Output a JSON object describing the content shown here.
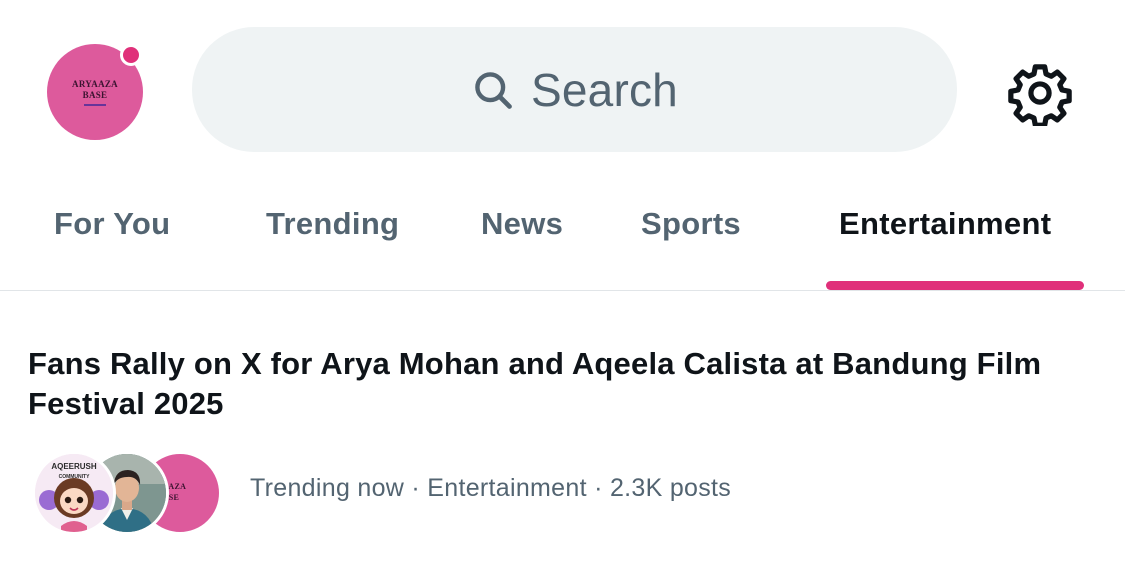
{
  "header": {
    "avatar_logo": [
      "ARYAAZA",
      "BASE"
    ],
    "search_placeholder": "Search",
    "search_icon": "search-icon",
    "settings_icon": "gear-icon",
    "notification_dot_color": "#e0307a"
  },
  "tabs": [
    {
      "label": "For You",
      "active": false
    },
    {
      "label": "Trending",
      "active": false
    },
    {
      "label": "News",
      "active": false
    },
    {
      "label": "Sports",
      "active": false
    },
    {
      "label": "Entertainment",
      "active": true
    }
  ],
  "trend": {
    "title": "Fans Rally on X for Arya Mohan and Aqeela Calista at Bandung Film Festival 2025",
    "status": "Trending now",
    "category": "Entertainment",
    "posts": "2.3K posts",
    "avatar_labels": {
      "first": "AQEERUSH",
      "first_sub": "COMMUNITY",
      "third": [
        "YAAZA",
        "BASE"
      ]
    }
  },
  "colors": {
    "accent": "#e0307a",
    "avatar_pink": "#dd5a9c",
    "muted_text": "#536471",
    "search_bg": "#eff3f4"
  }
}
